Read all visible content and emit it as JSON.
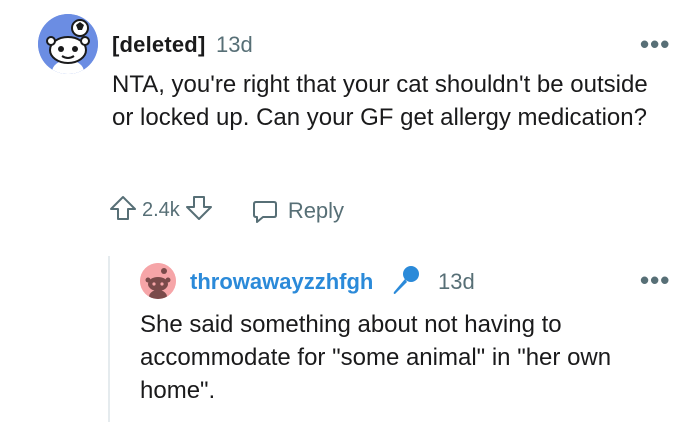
{
  "comment": {
    "author": "[deleted]",
    "time": "13d",
    "body": "NTA, you're right that your cat shouldn't be outside or locked up. Can your GF get allergy medication?",
    "votes": "2.4k",
    "reply_label": "Reply",
    "avatar_icon": "snoo-avatar-icon",
    "more_icon": "more-options-icon"
  },
  "reply": {
    "author": "throwawayzzhfgh",
    "time": "13d",
    "body": "She said something about not having to accommodate for \"some animal\" in \"her own home\".",
    "author_badge_icon": "microphone-icon",
    "author_color": "#2b8ad9"
  },
  "colors": {
    "avatar_bg": "#6b8de3",
    "reply_avatar_bg": "#f6a5a8",
    "muted": "#576f76",
    "thread_line": "#e5ebee"
  }
}
